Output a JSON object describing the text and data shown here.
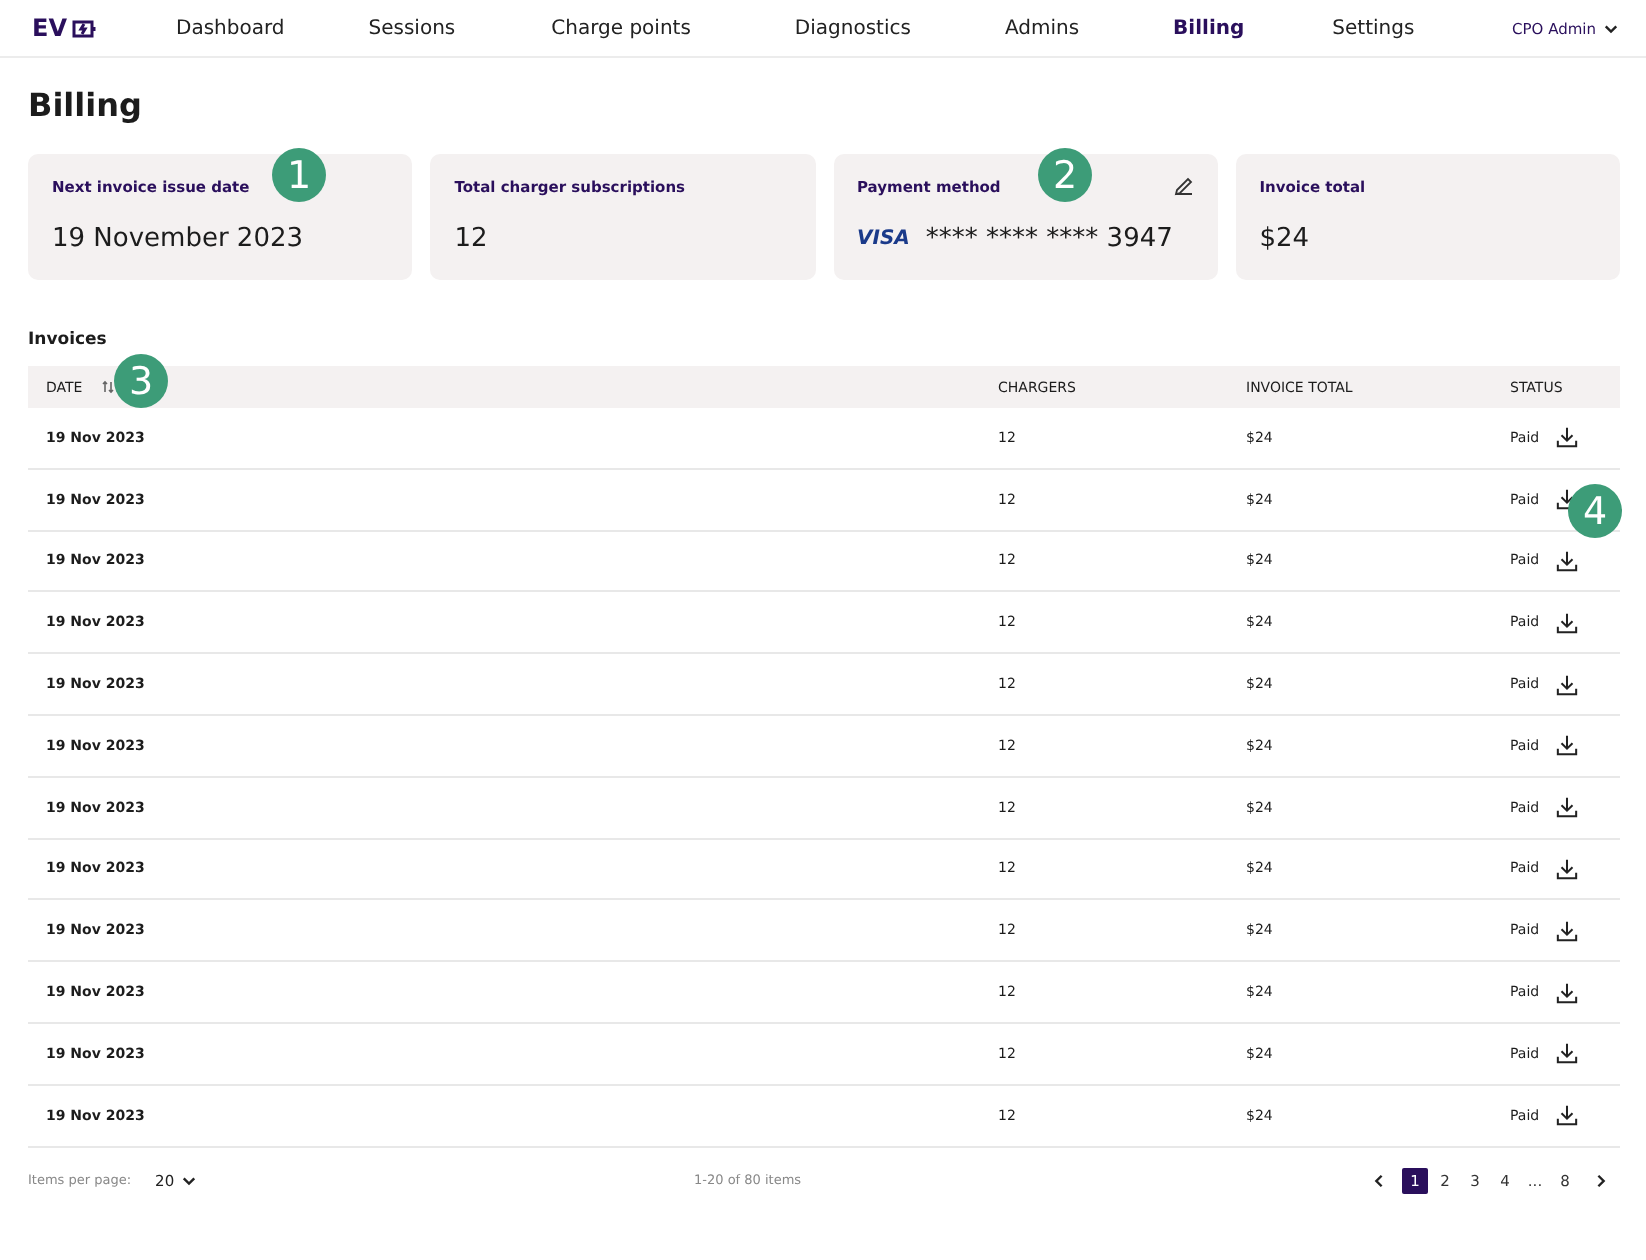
{
  "nav": {
    "logo": "EV",
    "items": [
      {
        "label": "Dashboard",
        "selected": false
      },
      {
        "label": "Sessions",
        "selected": false
      },
      {
        "label": "Charge points",
        "selected": false
      },
      {
        "label": "Diagnostics",
        "selected": false
      },
      {
        "label": "Admins",
        "selected": false
      },
      {
        "label": "Billing",
        "selected": true
      },
      {
        "label": "Settings",
        "selected": false
      }
    ],
    "user": "CPO Admin"
  },
  "page_title": "Billing",
  "cards": [
    {
      "kind": "text",
      "label": "Next invoice issue date",
      "value": "19 November 2023"
    },
    {
      "kind": "text",
      "label": "Total charger subscriptions",
      "value": "12"
    },
    {
      "kind": "payment",
      "label": "Payment method",
      "brand": "VISA",
      "value": "**** **** **** 3947"
    },
    {
      "kind": "text",
      "label": "Invoice total",
      "value": "$24"
    }
  ],
  "invoices": {
    "title": "Invoices",
    "columns": [
      "DATE",
      "CHARGERS",
      "INVOICE TOTAL",
      "STATUS"
    ],
    "rows": [
      {
        "date": "19 Nov 2023",
        "chargers": "12",
        "total": "$24",
        "status": "Paid"
      },
      {
        "date": "19 Nov 2023",
        "chargers": "12",
        "total": "$24",
        "status": "Paid"
      },
      {
        "date": "19 Nov 2023",
        "chargers": "12",
        "total": "$24",
        "status": "Paid"
      },
      {
        "date": "19 Nov 2023",
        "chargers": "12",
        "total": "$24",
        "status": "Paid"
      },
      {
        "date": "19 Nov 2023",
        "chargers": "12",
        "total": "$24",
        "status": "Paid"
      },
      {
        "date": "19 Nov 2023",
        "chargers": "12",
        "total": "$24",
        "status": "Paid"
      },
      {
        "date": "19 Nov 2023",
        "chargers": "12",
        "total": "$24",
        "status": "Paid"
      },
      {
        "date": "19 Nov 2023",
        "chargers": "12",
        "total": "$24",
        "status": "Paid"
      },
      {
        "date": "19 Nov 2023",
        "chargers": "12",
        "total": "$24",
        "status": "Paid"
      },
      {
        "date": "19 Nov 2023",
        "chargers": "12",
        "total": "$24",
        "status": "Paid"
      },
      {
        "date": "19 Nov 2023",
        "chargers": "12",
        "total": "$24",
        "status": "Paid"
      },
      {
        "date": "19 Nov 2023",
        "chargers": "12",
        "total": "$24",
        "status": "Paid"
      }
    ]
  },
  "footer": {
    "per_page_label": "Items per page:",
    "per_page": "20",
    "range": "1-20 of 80 items",
    "pages": [
      {
        "label": "1",
        "selected": true
      },
      {
        "label": "2",
        "selected": false
      },
      {
        "label": "3",
        "selected": false
      },
      {
        "label": "4",
        "selected": false
      },
      {
        "label": "...",
        "selected": false
      },
      {
        "label": "8",
        "selected": false
      }
    ]
  },
  "callouts": [
    "1",
    "2",
    "3",
    "4"
  ]
}
